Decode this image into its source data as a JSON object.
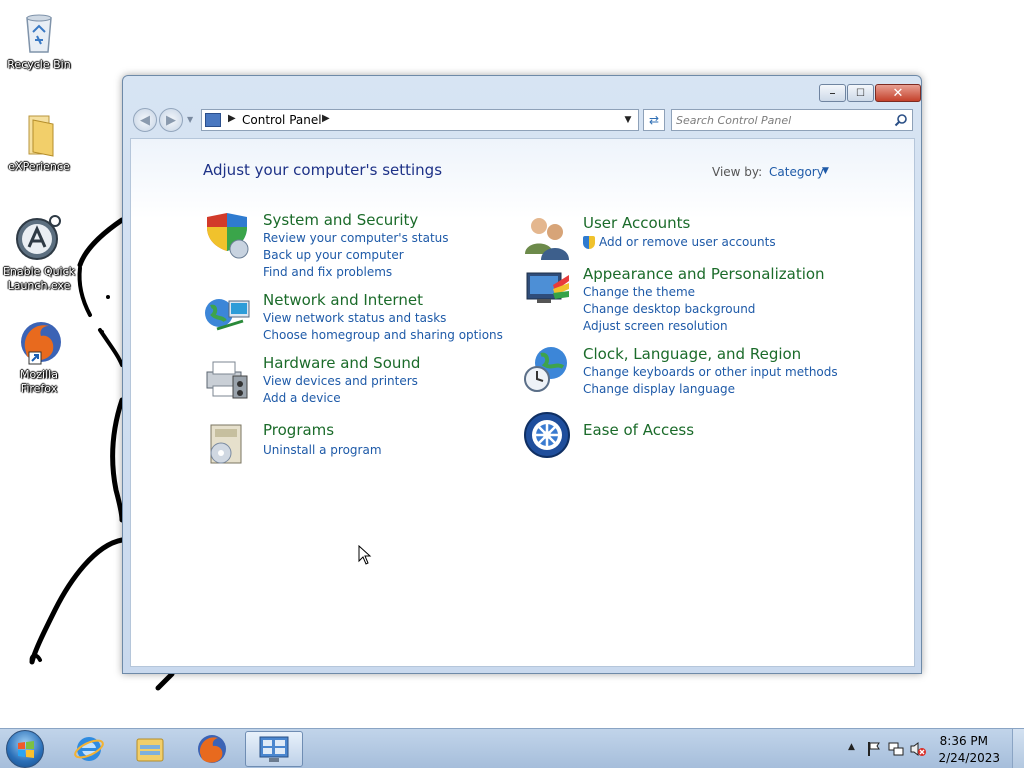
{
  "desktop": {
    "icons": [
      {
        "label": "Recycle Bin",
        "icon": "recycle-bin-icon"
      },
      {
        "label": "eXPerience",
        "icon": "folder-icon"
      },
      {
        "label": "Enable Quick Launch.exe",
        "icon": "app-icon"
      },
      {
        "label": "Mozilla Firefox",
        "icon": "firefox-icon"
      }
    ]
  },
  "window": {
    "breadcrumb": "Control Panel",
    "search_placeholder": "Search Control Panel",
    "heading": "Adjust your computer's settings",
    "view_by_label": "View by:",
    "view_by_value": "Category",
    "categories": [
      {
        "title": "System and Security",
        "icon": "shield-icon",
        "links": [
          "Review your computer's status",
          "Back up your computer",
          "Find and fix problems"
        ]
      },
      {
        "title": "Network and Internet",
        "icon": "network-icon",
        "links": [
          "View network status and tasks",
          "Choose homegroup and sharing options"
        ]
      },
      {
        "title": "Hardware and Sound",
        "icon": "printer-icon",
        "links": [
          "View devices and printers",
          "Add a device"
        ]
      },
      {
        "title": "Programs",
        "icon": "programs-icon",
        "links": [
          "Uninstall a program"
        ]
      },
      {
        "title": "User Accounts",
        "icon": "users-icon",
        "links": [
          "Add or remove user accounts"
        ]
      },
      {
        "title": "Appearance and Personalization",
        "icon": "appearance-icon",
        "links": [
          "Change the theme",
          "Change desktop background",
          "Adjust screen resolution"
        ]
      },
      {
        "title": "Clock, Language, and Region",
        "icon": "globe-clock-icon",
        "links": [
          "Change keyboards or other input methods",
          "Change display language"
        ]
      },
      {
        "title": "Ease of Access",
        "icon": "ease-of-access-icon",
        "links": []
      }
    ]
  },
  "taskbar": {
    "pinned": [
      "start-orb",
      "internet-explorer-icon",
      "windows-explorer-icon",
      "firefox-icon",
      "control-panel-icon"
    ],
    "tray": {
      "time": "8:36 PM",
      "date": "2/24/2023"
    }
  }
}
